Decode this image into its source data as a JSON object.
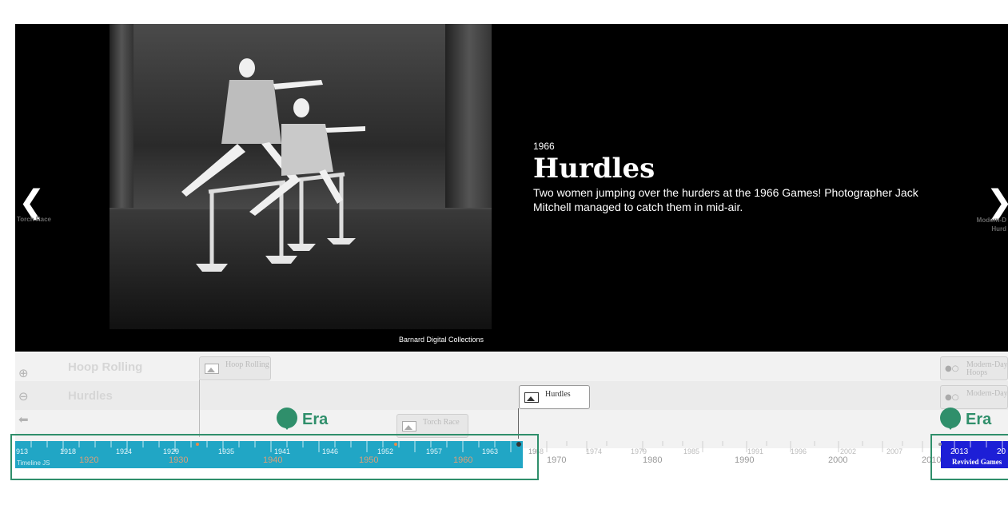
{
  "slide": {
    "date": "1966",
    "title": "Hurdles",
    "description": "Two women jumping over the hurders at the 1966 Games! Photographer Jack Mitchell managed to catch them in mid-air.",
    "credit": "Barnard Digital Collections",
    "prev_label": "Torch Race",
    "next_label_line1": "Modern-D",
    "next_label_line2": "Hurd"
  },
  "groups": [
    "Hoop Rolling",
    "Hurdles"
  ],
  "markers": {
    "hoop_rolling": "Hoop Rolling",
    "torch_race": "Torch Race",
    "hurdles": "Hurdles",
    "modern_day_hoops": "Modern-Day Hoops",
    "modern_day": "Modern-Day..."
  },
  "axis": {
    "minor_labels_era1": [
      "913",
      "1918",
      "1924",
      "1929",
      "1935",
      "1941",
      "1946",
      "1952",
      "1957",
      "1963",
      "19"
    ],
    "major_labels_era1": [
      "1920",
      "1930",
      "1940",
      "1950",
      "1960"
    ],
    "minor_labels_rest": [
      "68",
      "1974",
      "1979",
      "1985",
      "1991",
      "1996",
      "2002",
      "2007",
      "2010"
    ],
    "major_labels_rest": [
      "1970",
      "1980",
      "1990",
      "2000"
    ],
    "era2_labels": [
      "2013",
      "20"
    ],
    "brand": "Timeline JS"
  },
  "eras": {
    "era1_label": "Era",
    "era2_label": "Era",
    "era2_name": "Revivied Games"
  },
  "colors": {
    "era1": "#21a6c5",
    "era2": "#1d1fd6",
    "annotation": "#2f8f6b"
  }
}
